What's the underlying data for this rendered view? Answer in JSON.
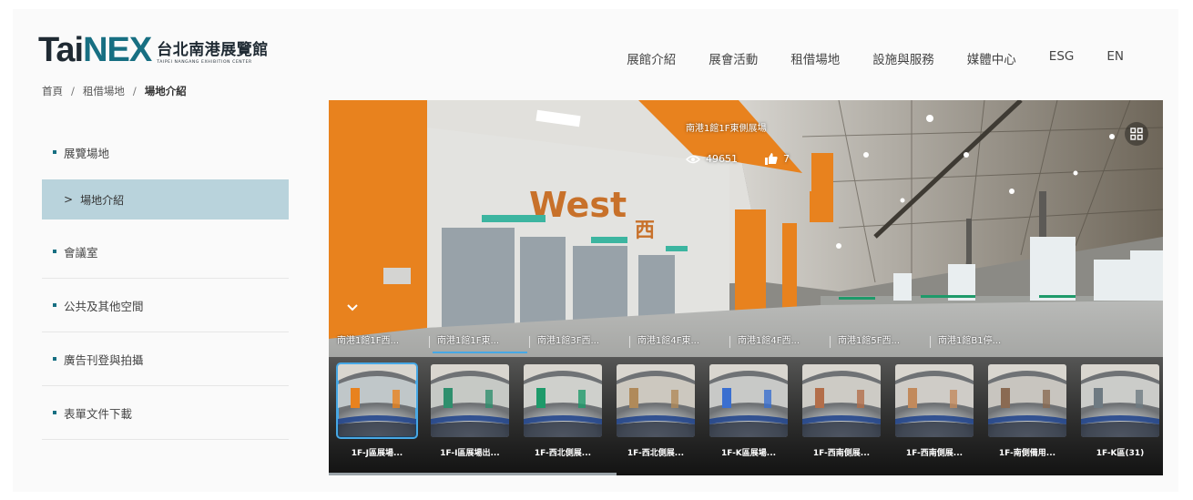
{
  "header": {
    "logo": {
      "main_a": "Tai",
      "main_b": "NEX",
      "zh": "台北南港展覽館",
      "en": "TAIPEI NANGANG EXHIBITION CENTER"
    },
    "nav": [
      "展館介紹",
      "展會活動",
      "租借場地",
      "設施與服務",
      "媒體中心",
      "ESG",
      "EN"
    ]
  },
  "breadcrumb": {
    "home": "首頁",
    "sep": "/",
    "parent": "租借場地",
    "current": "場地介紹"
  },
  "sidebar": {
    "items": [
      {
        "label": "展覽場地"
      },
      {
        "label": "場地介紹",
        "prefix": ">"
      },
      {
        "label": "會議室"
      },
      {
        "label": "公共及其他空間"
      },
      {
        "label": "廣告刊登與拍攝"
      },
      {
        "label": "表單文件下載"
      }
    ]
  },
  "viewer": {
    "scene_title": "南港1館1F東側展場",
    "views": "49651",
    "likes": "7",
    "sign_text": "West 西",
    "tabs": [
      "南港1館1F西...",
      "南港1館1F東...",
      "南港1館3F西...",
      "南港1館4F東...",
      "南港1館4F西...",
      "南港1館5F西...",
      "南港1館B1停..."
    ],
    "active_tab": 1,
    "thumbnails": [
      "1F-J區展場...",
      "1F-I區展場出...",
      "1F-西北側展...",
      "1F-西北側展...",
      "1F-K區展場...",
      "1F-西南側展...",
      "1F-西南側展...",
      "1F-南側備用...",
      "1F-K區(31)"
    ],
    "active_thumb": 0,
    "colors": {
      "accent": "#47a8e5",
      "brand": "#176f82",
      "orange": "#e8821e"
    }
  }
}
